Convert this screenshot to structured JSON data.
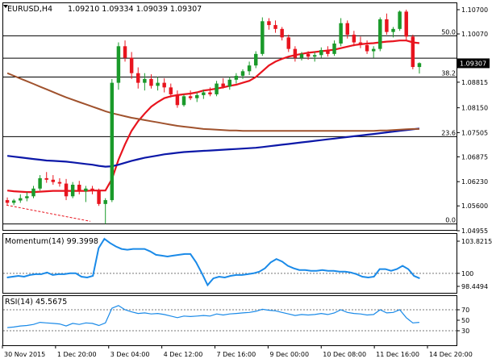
{
  "header": {
    "symbol_tf": "EURUSD,H4",
    "ohlc": "1.09210 1.09334 1.09039 1.09307"
  },
  "colors": {
    "bull": "#1a9a2a",
    "bear": "#e8141e",
    "ma_fast": "#e8141e",
    "ma_mid": "#0c18a8",
    "ma_slow": "#a0522d",
    "indicator": "#1a8ae8",
    "fib": "#000000"
  },
  "chart_data": [
    {
      "type": "candlestick",
      "panel": "price",
      "ylim": [
        1.04955,
        1.11
      ],
      "yticks": [
        "1.10700",
        "1.10070",
        "1.09307",
        "1.08815",
        "1.08150",
        "1.07505",
        "1.06875",
        "1.06230",
        "1.05600",
        "1.04955"
      ],
      "current_price": "1.09307",
      "x_labels": [
        "30 Nov 2015",
        "1 Dec 20:00",
        "3 Dec 04:00",
        "4 Dec 12:00",
        "7 Dec 16:00",
        "9 Dec 00:00",
        "10 Dec 08:00",
        "11 Dec 16:00",
        "14 Dec 20:00"
      ],
      "fib_levels": [
        {
          "label": "50.0",
          "price": 1.1002
        },
        {
          "label": "",
          "price": 1.0944
        },
        {
          "label": "38.2",
          "price": 1.0895
        },
        {
          "label": "23.6",
          "price": 1.074
        },
        {
          "label": "0.0",
          "price": 1.0513
        }
      ],
      "candles": [
        {
          "o": 1.0575,
          "h": 1.0582,
          "l": 1.0563,
          "c": 1.0568
        },
        {
          "o": 1.0568,
          "h": 1.0578,
          "l": 1.0562,
          "c": 1.0574
        },
        {
          "o": 1.0574,
          "h": 1.059,
          "l": 1.0568,
          "c": 1.058
        },
        {
          "o": 1.058,
          "h": 1.0596,
          "l": 1.0572,
          "c": 1.0585
        },
        {
          "o": 1.0585,
          "h": 1.0612,
          "l": 1.058,
          "c": 1.0605
        },
        {
          "o": 1.0605,
          "h": 1.064,
          "l": 1.06,
          "c": 1.0632
        },
        {
          "o": 1.0632,
          "h": 1.0648,
          "l": 1.062,
          "c": 1.0628
        },
        {
          "o": 1.0628,
          "h": 1.064,
          "l": 1.0615,
          "c": 1.0622
        },
        {
          "o": 1.0622,
          "h": 1.0632,
          "l": 1.061,
          "c": 1.0618
        },
        {
          "o": 1.0618,
          "h": 1.063,
          "l": 1.0575,
          "c": 1.0585
        },
        {
          "o": 1.0585,
          "h": 1.0622,
          "l": 1.058,
          "c": 1.0615
        },
        {
          "o": 1.0615,
          "h": 1.0625,
          "l": 1.059,
          "c": 1.0598
        },
        {
          "o": 1.0598,
          "h": 1.0612,
          "l": 1.057,
          "c": 1.0605
        },
        {
          "o": 1.0605,
          "h": 1.0612,
          "l": 1.059,
          "c": 1.06
        },
        {
          "o": 1.06,
          "h": 1.0605,
          "l": 1.056,
          "c": 1.0565
        },
        {
          "o": 1.0565,
          "h": 1.058,
          "l": 1.0513,
          "c": 1.0575
        },
        {
          "o": 1.0575,
          "h": 1.089,
          "l": 1.057,
          "c": 1.088
        },
        {
          "o": 1.088,
          "h": 1.0985,
          "l": 1.0862,
          "c": 1.0975
        },
        {
          "o": 1.0975,
          "h": 1.099,
          "l": 1.0935,
          "c": 1.0945
        },
        {
          "o": 1.0945,
          "h": 1.096,
          "l": 1.089,
          "c": 1.0905
        },
        {
          "o": 1.0905,
          "h": 1.092,
          "l": 1.0865,
          "c": 1.088
        },
        {
          "o": 1.088,
          "h": 1.0905,
          "l": 1.086,
          "c": 1.089
        },
        {
          "o": 1.089,
          "h": 1.0902,
          "l": 1.0865,
          "c": 1.0872
        },
        {
          "o": 1.0872,
          "h": 1.0895,
          "l": 1.086,
          "c": 1.088
        },
        {
          "o": 1.088,
          "h": 1.0892,
          "l": 1.0855,
          "c": 1.0868
        },
        {
          "o": 1.0868,
          "h": 1.0878,
          "l": 1.0842,
          "c": 1.085
        },
        {
          "o": 1.085,
          "h": 1.086,
          "l": 1.0815,
          "c": 1.0822
        },
        {
          "o": 1.0822,
          "h": 1.085,
          "l": 1.0818,
          "c": 1.0845
        },
        {
          "o": 1.0845,
          "h": 1.086,
          "l": 1.0835,
          "c": 1.084
        },
        {
          "o": 1.084,
          "h": 1.0855,
          "l": 1.083,
          "c": 1.0848
        },
        {
          "o": 1.0848,
          "h": 1.0862,
          "l": 1.0838,
          "c": 1.0855
        },
        {
          "o": 1.0855,
          "h": 1.0868,
          "l": 1.0845,
          "c": 1.085
        },
        {
          "o": 1.085,
          "h": 1.0885,
          "l": 1.0845,
          "c": 1.0878
        },
        {
          "o": 1.0878,
          "h": 1.0892,
          "l": 1.0865,
          "c": 1.087
        },
        {
          "o": 1.087,
          "h": 1.0895,
          "l": 1.0862,
          "c": 1.0888
        },
        {
          "o": 1.0888,
          "h": 1.0905,
          "l": 1.0878,
          "c": 1.0898
        },
        {
          "o": 1.0898,
          "h": 1.0915,
          "l": 1.089,
          "c": 1.091
        },
        {
          "o": 1.091,
          "h": 1.0935,
          "l": 1.09,
          "c": 1.0925
        },
        {
          "o": 1.0925,
          "h": 1.0962,
          "l": 1.0918,
          "c": 1.0955
        },
        {
          "o": 1.0955,
          "h": 1.105,
          "l": 1.095,
          "c": 1.104
        },
        {
          "o": 1.104,
          "h": 1.1048,
          "l": 1.1018,
          "c": 1.103
        },
        {
          "o": 1.103,
          "h": 1.1042,
          "l": 1.101,
          "c": 1.102
        },
        {
          "o": 1.102,
          "h": 1.1025,
          "l": 1.099,
          "c": 1.0998
        },
        {
          "o": 1.0998,
          "h": 1.1005,
          "l": 1.096,
          "c": 1.0968
        },
        {
          "o": 1.0968,
          "h": 1.0975,
          "l": 1.0935,
          "c": 1.0945
        },
        {
          "o": 1.0945,
          "h": 1.096,
          "l": 1.0938,
          "c": 1.0955
        },
        {
          "o": 1.0955,
          "h": 1.0962,
          "l": 1.094,
          "c": 1.0948
        },
        {
          "o": 1.0948,
          "h": 1.096,
          "l": 1.0935,
          "c": 1.0952
        },
        {
          "o": 1.0952,
          "h": 1.0972,
          "l": 1.0945,
          "c": 1.0965
        },
        {
          "o": 1.0965,
          "h": 1.0975,
          "l": 1.0948,
          "c": 1.0955
        },
        {
          "o": 1.0955,
          "h": 1.099,
          "l": 1.095,
          "c": 1.0982
        },
        {
          "o": 1.0982,
          "h": 1.1048,
          "l": 1.0975,
          "c": 1.1035
        },
        {
          "o": 1.1035,
          "h": 1.1042,
          "l": 1.0995,
          "c": 1.1005
        },
        {
          "o": 1.1005,
          "h": 1.1015,
          "l": 1.0975,
          "c": 1.0985
        },
        {
          "o": 1.0985,
          "h": 1.1,
          "l": 1.097,
          "c": 1.0978
        },
        {
          "o": 1.0978,
          "h": 1.099,
          "l": 1.0955,
          "c": 1.0962
        },
        {
          "o": 1.0962,
          "h": 1.0975,
          "l": 1.0945,
          "c": 1.0968
        },
        {
          "o": 1.0968,
          "h": 1.105,
          "l": 1.0962,
          "c": 1.1045
        },
        {
          "o": 1.1045,
          "h": 1.106,
          "l": 1.1005,
          "c": 1.1012
        },
        {
          "o": 1.1012,
          "h": 1.1025,
          "l": 1.0998,
          "c": 1.102
        },
        {
          "o": 1.102,
          "h": 1.1068,
          "l": 1.1015,
          "c": 1.1065
        },
        {
          "o": 1.1065,
          "h": 1.107,
          "l": 1.099,
          "c": 1.1
        },
        {
          "o": 1.1,
          "h": 1.1005,
          "l": 1.0915,
          "c": 1.0921
        },
        {
          "o": 1.0921,
          "h": 1.0933,
          "l": 1.0904,
          "c": 1.0931
        }
      ],
      "series": [
        {
          "name": "",
          "role": "ma_fast",
          "values": [
            1.06,
            1.0598,
            1.0597,
            1.0596,
            1.0596,
            1.0597,
            1.0598,
            1.0599,
            1.0599,
            1.0599,
            1.0599,
            1.0599,
            1.0599,
            1.06,
            1.06,
            1.06,
            1.063,
            1.068,
            1.072,
            1.0755,
            1.078,
            1.08,
            1.0818,
            1.083,
            1.084,
            1.0845,
            1.0848,
            1.085,
            1.0852,
            1.0855,
            1.086,
            1.0862,
            1.0865,
            1.0868,
            1.0872,
            1.0875,
            1.088,
            1.0885,
            1.0895,
            1.091,
            1.0925,
            1.0935,
            1.0942,
            1.0948,
            1.0952,
            1.0955,
            1.0958,
            1.096,
            1.0962,
            1.0964,
            1.0966,
            1.097,
            1.0974,
            1.0978,
            1.098,
            1.0982,
            1.0983,
            1.0985,
            1.0987,
            1.0988,
            1.099,
            1.099,
            1.0985,
            1.0983
          ]
        },
        {
          "name": "",
          "role": "ma_mid",
          "values": [
            1.069,
            1.0688,
            1.0686,
            1.0684,
            1.0682,
            1.068,
            1.0678,
            1.0677,
            1.0676,
            1.0675,
            1.0673,
            1.0671,
            1.0669,
            1.0667,
            1.0664,
            1.0662,
            1.0663,
            1.0667,
            1.0672,
            1.0677,
            1.0681,
            1.0685,
            1.0688,
            1.0691,
            1.0694,
            1.0696,
            1.0698,
            1.07,
            1.0701,
            1.0702,
            1.0703,
            1.0704,
            1.0705,
            1.0706,
            1.0707,
            1.0708,
            1.0709,
            1.071,
            1.0711,
            1.0713,
            1.0715,
            1.0717,
            1.0719,
            1.0721,
            1.0723,
            1.0725,
            1.0727,
            1.0729,
            1.0731,
            1.0733,
            1.0735,
            1.0737,
            1.0739,
            1.0741,
            1.0743,
            1.0745,
            1.0747,
            1.0749,
            1.0751,
            1.0753,
            1.0755,
            1.0757,
            1.0759,
            1.0761
          ]
        },
        {
          "name": "",
          "role": "ma_slow",
          "values": [
            1.0905,
            1.0898,
            1.0891,
            1.0884,
            1.0877,
            1.087,
            1.0863,
            1.0856,
            1.0849,
            1.0842,
            1.0836,
            1.083,
            1.0824,
            1.0818,
            1.0812,
            1.0806,
            1.0801,
            1.0797,
            1.0793,
            1.0789,
            1.0786,
            1.0783,
            1.078,
            1.0777,
            1.0774,
            1.0771,
            1.0768,
            1.0766,
            1.0764,
            1.0762,
            1.076,
            1.0759,
            1.0758,
            1.0757,
            1.0756,
            1.0756,
            1.0755,
            1.0755,
            1.0755,
            1.0755,
            1.0755,
            1.0755,
            1.0755,
            1.0755,
            1.0755,
            1.0755,
            1.0755,
            1.0755,
            1.0755,
            1.0755,
            1.0755,
            1.0755,
            1.0755,
            1.0755,
            1.0755,
            1.0755,
            1.0755,
            1.0756,
            1.0756,
            1.0757,
            1.0758,
            1.0759,
            1.076,
            1.076
          ]
        },
        {
          "name": "",
          "role": "trend",
          "values": [
            1.0562,
            1.052
          ]
        }
      ]
    },
    {
      "type": "line",
      "panel": "momentum",
      "title": "Momentum(14) 99.3998",
      "yticks": [
        "103.8215",
        "100",
        "98.4494"
      ],
      "ylim": [
        98.0,
        104.2
      ],
      "level": 100,
      "series": [
        {
          "name": "Momentum(14)",
          "values": [
            99.5,
            99.6,
            99.7,
            99.6,
            99.8,
            99.9,
            99.9,
            100.1,
            99.8,
            99.9,
            99.9,
            100.0,
            100.0,
            99.6,
            99.5,
            99.7,
            103.0,
            104.1,
            103.6,
            103.2,
            102.9,
            102.8,
            102.9,
            102.9,
            102.9,
            102.6,
            102.2,
            102.1,
            102.0,
            102.1,
            102.2,
            102.3,
            102.3,
            101.3,
            100.0,
            98.6,
            99.4,
            99.6,
            99.5,
            99.7,
            99.8,
            99.8,
            99.9,
            100.0,
            100.2,
            100.6,
            101.3,
            101.7,
            101.4,
            100.9,
            100.6,
            100.4,
            100.4,
            100.3,
            100.3,
            100.4,
            100.3,
            100.3,
            100.2,
            100.2,
            100.1,
            99.9,
            99.6,
            99.5,
            99.6,
            100.5,
            100.5,
            100.3,
            100.5,
            100.9,
            100.5,
            99.7,
            99.4
          ]
        }
      ]
    },
    {
      "type": "line",
      "panel": "rsi",
      "title": "RSI(14) 45.5675",
      "yticks": [
        "70",
        "50",
        "30"
      ],
      "ylim": [
        0,
        100
      ],
      "levels": [
        70,
        30
      ],
      "series": [
        {
          "name": "RSI(14)",
          "values": [
            36,
            37,
            39,
            40,
            42,
            46,
            45,
            44,
            43,
            39,
            44,
            42,
            45,
            44,
            40,
            45,
            73,
            78,
            70,
            66,
            63,
            64,
            62,
            63,
            61,
            58,
            55,
            58,
            57,
            58,
            59,
            58,
            62,
            60,
            62,
            63,
            64,
            65,
            67,
            71,
            69,
            68,
            65,
            62,
            59,
            61,
            60,
            61,
            63,
            61,
            64,
            70,
            65,
            63,
            62,
            60,
            61,
            70,
            64,
            65,
            70,
            55,
            45,
            46
          ]
        }
      ]
    }
  ]
}
